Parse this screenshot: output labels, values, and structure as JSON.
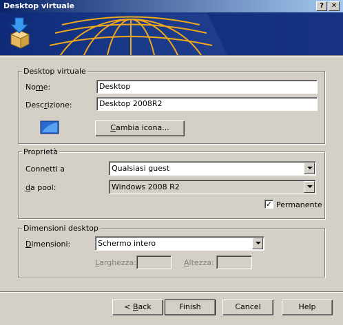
{
  "window": {
    "title": "Desktop virtuale",
    "help_glyph": "?",
    "close_glyph": "✕"
  },
  "group_desktop": {
    "label": "Desktop virtuale",
    "nome_label_pre": "No",
    "nome_label_u": "m",
    "nome_label_post": "e:",
    "nome_value": "Desktop",
    "descrizione_label_pre": "Desc",
    "descrizione_label_u": "r",
    "descrizione_label_post": "izione:",
    "descrizione_value": "Desktop 2008R2",
    "change_icon_u": "C",
    "change_icon_rest": "ambia icona..."
  },
  "group_props": {
    "label": "Proprietà",
    "connect_label": "Connetti a",
    "connect_value": "Qualsiasi guest",
    "pool_label_u": "d",
    "pool_label_rest": "a pool:",
    "pool_value": "Windows 2008 R2",
    "permanent_label": "Permanente",
    "permanent_checked": "✓"
  },
  "group_dims": {
    "label": "Dimensioni desktop",
    "dims_label_u": "D",
    "dims_label_rest": "imensioni:",
    "dims_value": "Schermo intero",
    "width_label_u": "L",
    "width_label_rest": "arghezza:",
    "width_value": "",
    "height_label_u": "A",
    "height_label_rest": "ltezza:",
    "height_value": ""
  },
  "buttons": {
    "back_pre": "< ",
    "back_u": "B",
    "back_rest": "ack",
    "finish": "Finish",
    "cancel": "Cancel",
    "help": "Help"
  }
}
